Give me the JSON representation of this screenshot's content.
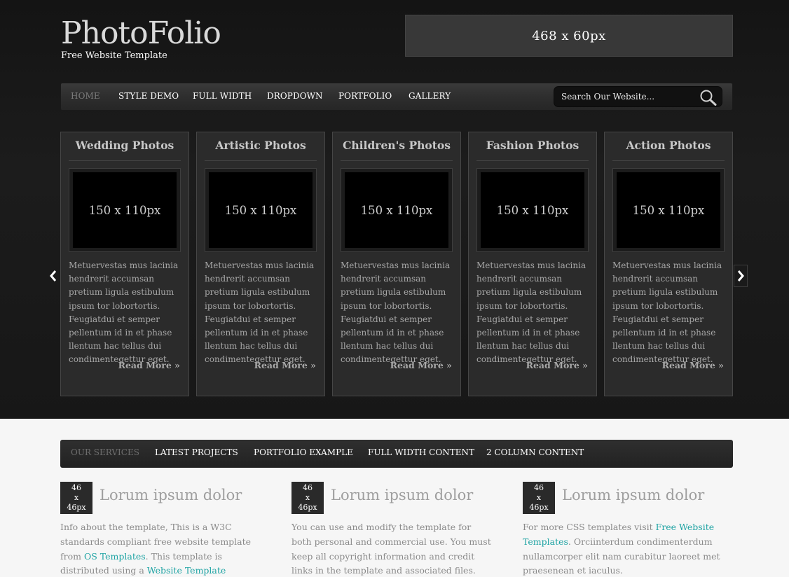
{
  "header": {
    "logo": "PhotoFolio",
    "tagline": "Free Website Template",
    "banner": "468 x 60px"
  },
  "main_nav": {
    "items": [
      "HOME",
      "STYLE DEMO",
      "FULL WIDTH",
      "DROPDOWN",
      "PORTFOLIO",
      "GALLERY"
    ],
    "active": "HOME"
  },
  "search": {
    "placeholder": "Search Our Website..."
  },
  "slider": {
    "cards": [
      {
        "title": "Wedding Photos",
        "thumb": "150 x 110px",
        "body": "Metuervestas mus lacinia hendrerit accumsan pretium ligula estibulum ipsum tor lobortortis. Feugiatdui et semper pellentum id in et phase llentum hac tellus dui condimentegettur eget.",
        "more": "Read More »"
      },
      {
        "title": "Artistic Photos",
        "thumb": "150 x 110px",
        "body": "Metuervestas mus lacinia hendrerit accumsan pretium ligula estibulum ipsum tor lobortortis. Feugiatdui et semper pellentum id in et phase llentum hac tellus dui condimentegettur eget.",
        "more": "Read More »"
      },
      {
        "title": "Children's Photos",
        "thumb": "150 x 110px",
        "body": "Metuervestas mus lacinia hendrerit accumsan pretium ligula estibulum ipsum tor lobortortis. Feugiatdui et semper pellentum id in et phase llentum hac tellus dui condimentegettur eget.",
        "more": "Read More »"
      },
      {
        "title": "Fashion Photos",
        "thumb": "150 x 110px",
        "body": "Metuervestas mus lacinia hendrerit accumsan pretium ligula estibulum ipsum tor lobortortis. Feugiatdui et semper pellentum id in et phase llentum hac tellus dui condimentegettur eget.",
        "more": "Read More »"
      },
      {
        "title": "Action Photos",
        "thumb": "150 x 110px",
        "body": "Metuervestas mus lacinia hendrerit accumsan pretium ligula estibulum ipsum tor lobortortis. Feugiatdui et semper pellentum id in et phase llentum hac tellus dui condimentegettur eget.",
        "more": "Read More »"
      }
    ]
  },
  "sub_nav": {
    "items": [
      "OUR SERVICES",
      "LATEST PROJECTS",
      "PORTFOLIO EXAMPLE",
      "FULL WIDTH CONTENT",
      "2 COLUMN CONTENT"
    ],
    "active": "OUR SERVICES"
  },
  "services": [
    {
      "icon_lines": [
        "46",
        "x",
        "46px"
      ],
      "title": "Lorum ipsum dolor",
      "text_parts": [
        {
          "text": "Info about the template, This is a W3C standards compliant free website template from "
        },
        {
          "text": "OS Templates",
          "link": true
        },
        {
          "text": ". This template is distributed using a "
        },
        {
          "text": "Website Template Licence",
          "link": true
        },
        {
          "text": "."
        }
      ]
    },
    {
      "icon_lines": [
        "46",
        "x",
        "46px"
      ],
      "title": "Lorum ipsum dolor",
      "text_parts": [
        {
          "text": "You can use and modify the template for both personal and commercial use. You must keep all copyright information and credit links in the template and associated files."
        }
      ]
    },
    {
      "icon_lines": [
        "46",
        "x",
        "46px"
      ],
      "title": "Lorum ipsum dolor",
      "text_parts": [
        {
          "text": "For more CSS templates visit "
        },
        {
          "text": "Free Website Templates",
          "link": true
        },
        {
          "text": ". Orciinterdum condimenterdum nullamcorper elit nam curabitur laoreet met praesenean et iaculus."
        }
      ]
    }
  ],
  "colors": {
    "top_bg": "#171717",
    "bottom_bg": "#f6f6f6",
    "link": "#1ea3a3",
    "nav_active": "#7c7c7c"
  }
}
